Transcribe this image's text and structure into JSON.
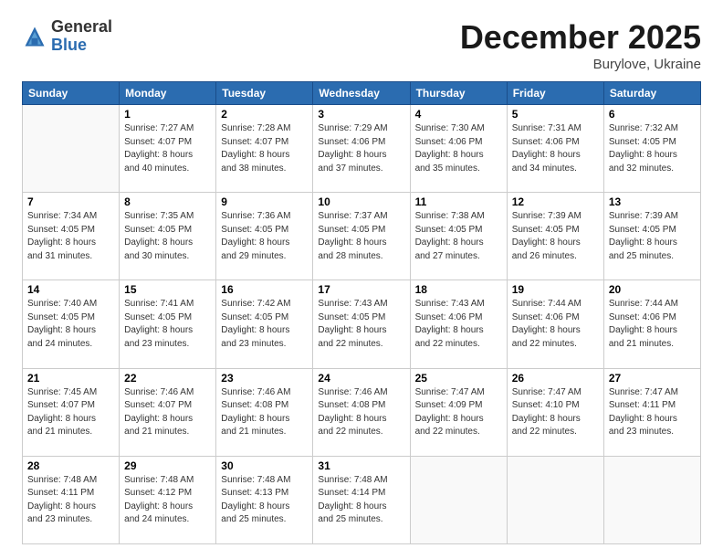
{
  "header": {
    "logo_general": "General",
    "logo_blue": "Blue",
    "title": "December 2025",
    "location": "Burylove, Ukraine"
  },
  "weekdays": [
    "Sunday",
    "Monday",
    "Tuesday",
    "Wednesday",
    "Thursday",
    "Friday",
    "Saturday"
  ],
  "weeks": [
    [
      {
        "num": "",
        "info": ""
      },
      {
        "num": "1",
        "info": "Sunrise: 7:27 AM\nSunset: 4:07 PM\nDaylight: 8 hours\nand 40 minutes."
      },
      {
        "num": "2",
        "info": "Sunrise: 7:28 AM\nSunset: 4:07 PM\nDaylight: 8 hours\nand 38 minutes."
      },
      {
        "num": "3",
        "info": "Sunrise: 7:29 AM\nSunset: 4:06 PM\nDaylight: 8 hours\nand 37 minutes."
      },
      {
        "num": "4",
        "info": "Sunrise: 7:30 AM\nSunset: 4:06 PM\nDaylight: 8 hours\nand 35 minutes."
      },
      {
        "num": "5",
        "info": "Sunrise: 7:31 AM\nSunset: 4:06 PM\nDaylight: 8 hours\nand 34 minutes."
      },
      {
        "num": "6",
        "info": "Sunrise: 7:32 AM\nSunset: 4:05 PM\nDaylight: 8 hours\nand 32 minutes."
      }
    ],
    [
      {
        "num": "7",
        "info": "Sunrise: 7:34 AM\nSunset: 4:05 PM\nDaylight: 8 hours\nand 31 minutes."
      },
      {
        "num": "8",
        "info": "Sunrise: 7:35 AM\nSunset: 4:05 PM\nDaylight: 8 hours\nand 30 minutes."
      },
      {
        "num": "9",
        "info": "Sunrise: 7:36 AM\nSunset: 4:05 PM\nDaylight: 8 hours\nand 29 minutes."
      },
      {
        "num": "10",
        "info": "Sunrise: 7:37 AM\nSunset: 4:05 PM\nDaylight: 8 hours\nand 28 minutes."
      },
      {
        "num": "11",
        "info": "Sunrise: 7:38 AM\nSunset: 4:05 PM\nDaylight: 8 hours\nand 27 minutes."
      },
      {
        "num": "12",
        "info": "Sunrise: 7:39 AM\nSunset: 4:05 PM\nDaylight: 8 hours\nand 26 minutes."
      },
      {
        "num": "13",
        "info": "Sunrise: 7:39 AM\nSunset: 4:05 PM\nDaylight: 8 hours\nand 25 minutes."
      }
    ],
    [
      {
        "num": "14",
        "info": "Sunrise: 7:40 AM\nSunset: 4:05 PM\nDaylight: 8 hours\nand 24 minutes."
      },
      {
        "num": "15",
        "info": "Sunrise: 7:41 AM\nSunset: 4:05 PM\nDaylight: 8 hours\nand 23 minutes."
      },
      {
        "num": "16",
        "info": "Sunrise: 7:42 AM\nSunset: 4:05 PM\nDaylight: 8 hours\nand 23 minutes."
      },
      {
        "num": "17",
        "info": "Sunrise: 7:43 AM\nSunset: 4:05 PM\nDaylight: 8 hours\nand 22 minutes."
      },
      {
        "num": "18",
        "info": "Sunrise: 7:43 AM\nSunset: 4:06 PM\nDaylight: 8 hours\nand 22 minutes."
      },
      {
        "num": "19",
        "info": "Sunrise: 7:44 AM\nSunset: 4:06 PM\nDaylight: 8 hours\nand 22 minutes."
      },
      {
        "num": "20",
        "info": "Sunrise: 7:44 AM\nSunset: 4:06 PM\nDaylight: 8 hours\nand 21 minutes."
      }
    ],
    [
      {
        "num": "21",
        "info": "Sunrise: 7:45 AM\nSunset: 4:07 PM\nDaylight: 8 hours\nand 21 minutes."
      },
      {
        "num": "22",
        "info": "Sunrise: 7:46 AM\nSunset: 4:07 PM\nDaylight: 8 hours\nand 21 minutes."
      },
      {
        "num": "23",
        "info": "Sunrise: 7:46 AM\nSunset: 4:08 PM\nDaylight: 8 hours\nand 21 minutes."
      },
      {
        "num": "24",
        "info": "Sunrise: 7:46 AM\nSunset: 4:08 PM\nDaylight: 8 hours\nand 22 minutes."
      },
      {
        "num": "25",
        "info": "Sunrise: 7:47 AM\nSunset: 4:09 PM\nDaylight: 8 hours\nand 22 minutes."
      },
      {
        "num": "26",
        "info": "Sunrise: 7:47 AM\nSunset: 4:10 PM\nDaylight: 8 hours\nand 22 minutes."
      },
      {
        "num": "27",
        "info": "Sunrise: 7:47 AM\nSunset: 4:11 PM\nDaylight: 8 hours\nand 23 minutes."
      }
    ],
    [
      {
        "num": "28",
        "info": "Sunrise: 7:48 AM\nSunset: 4:11 PM\nDaylight: 8 hours\nand 23 minutes."
      },
      {
        "num": "29",
        "info": "Sunrise: 7:48 AM\nSunset: 4:12 PM\nDaylight: 8 hours\nand 24 minutes."
      },
      {
        "num": "30",
        "info": "Sunrise: 7:48 AM\nSunset: 4:13 PM\nDaylight: 8 hours\nand 25 minutes."
      },
      {
        "num": "31",
        "info": "Sunrise: 7:48 AM\nSunset: 4:14 PM\nDaylight: 8 hours\nand 25 minutes."
      },
      {
        "num": "",
        "info": ""
      },
      {
        "num": "",
        "info": ""
      },
      {
        "num": "",
        "info": ""
      }
    ]
  ]
}
